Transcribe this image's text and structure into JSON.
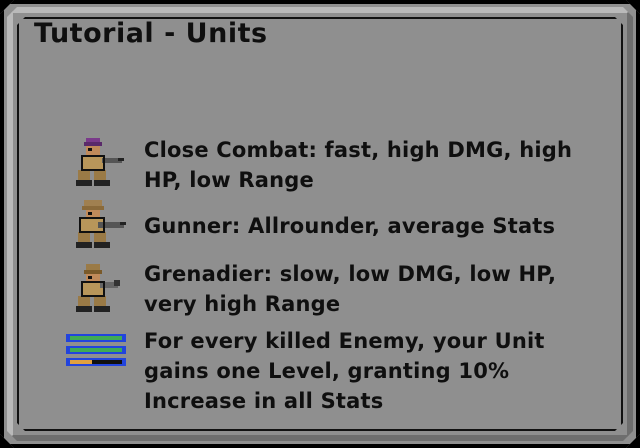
{
  "window": {
    "title": "Tutorial - Units"
  },
  "units": [
    {
      "icon": "close-combat-soldier-icon",
      "line1": "Close Combat: fast, high DMG, high",
      "line2": "HP, low Range"
    },
    {
      "icon": "gunner-soldier-icon",
      "line1": "Gunner: Allrounder, average Stats",
      "line2": ""
    },
    {
      "icon": "grenadier-soldier-icon",
      "line1": "Grenadier: slow, low DMG, low HP,",
      "line2": "very high Range"
    }
  ],
  "levels": {
    "icon": "level-bars-icon",
    "line1": "For every killed Enemy, your Unit",
    "line2": "gains one Level, granting 10%",
    "line3": "Increase in all Stats"
  },
  "colors": {
    "panel": "#8f8f8f",
    "text": "#0f0f0f",
    "khaki": "#b8965a",
    "bar_green": "#3faa55",
    "bar_blue": "#2244dd",
    "bar_orange": "#e0a040"
  }
}
